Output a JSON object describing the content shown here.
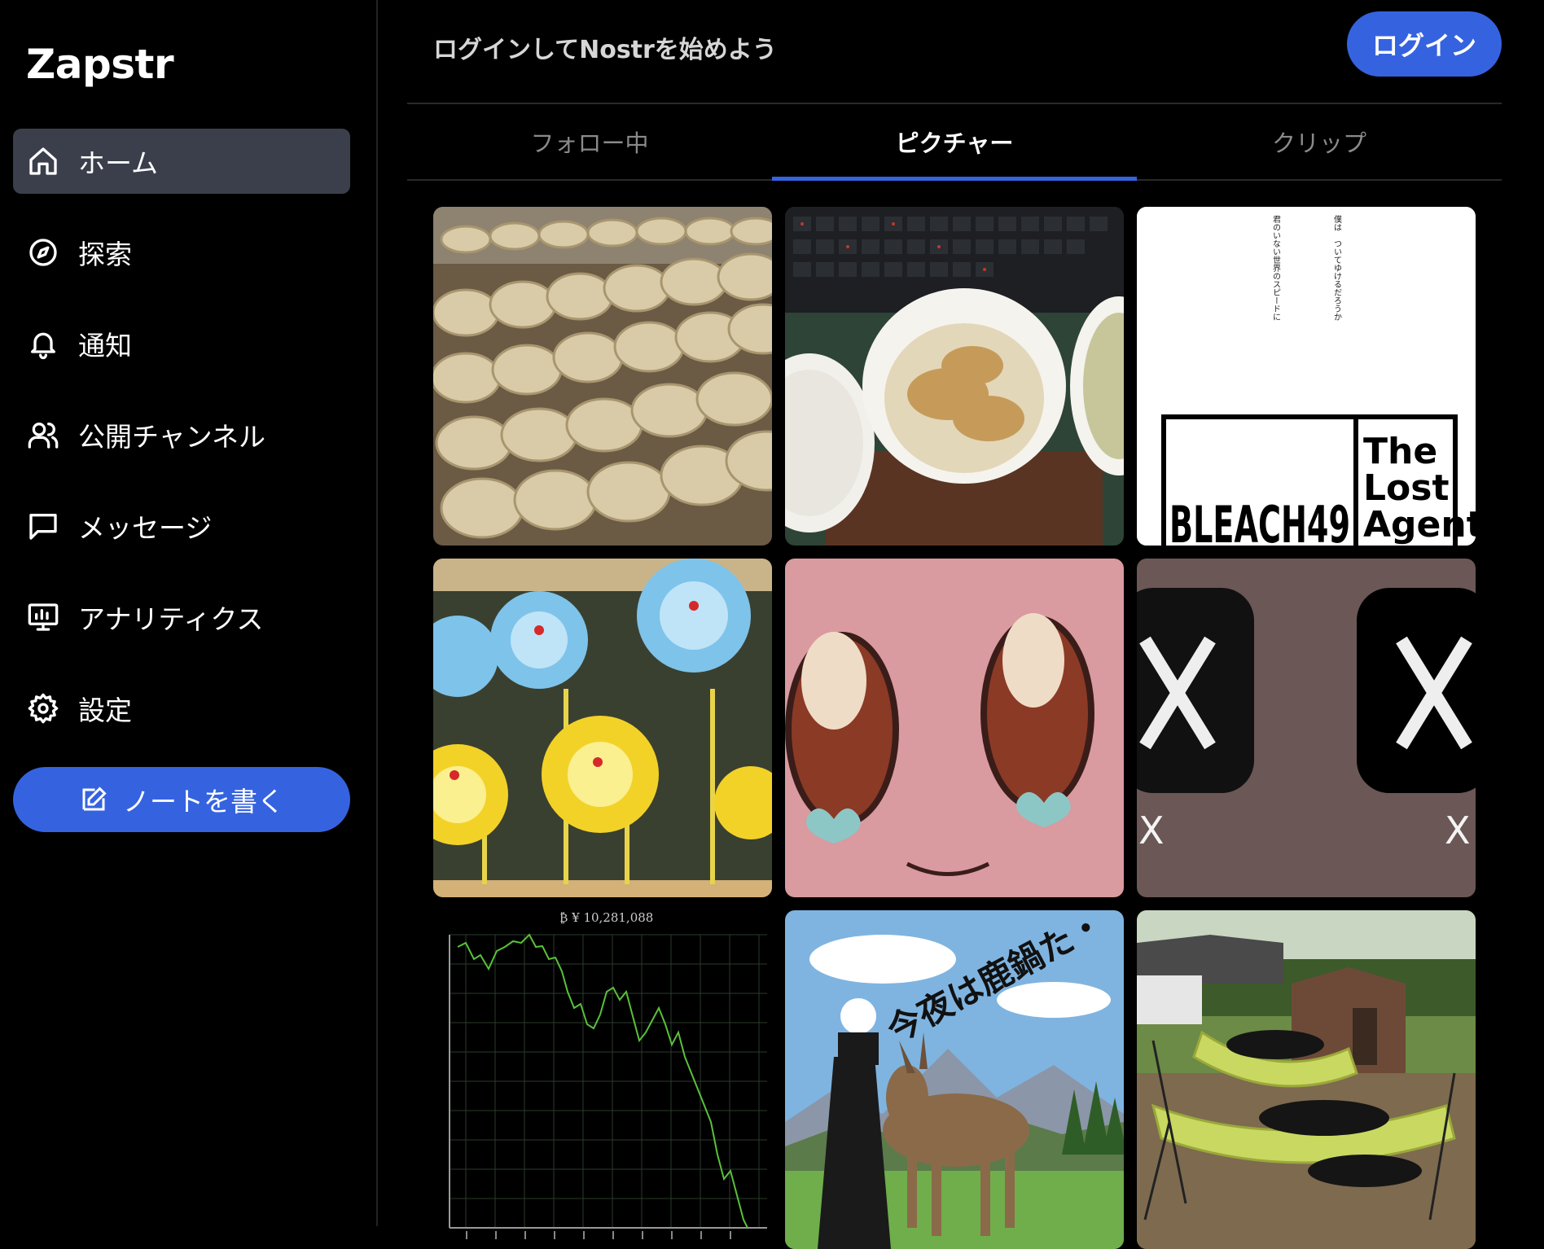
{
  "app": {
    "name": "Zapstr"
  },
  "sidebar": {
    "items": [
      {
        "label": "ホーム",
        "icon": "home-icon",
        "active": true
      },
      {
        "label": "探索",
        "icon": "compass-icon"
      },
      {
        "label": "通知",
        "icon": "bell-icon"
      },
      {
        "label": "公開チャンネル",
        "icon": "users-icon"
      },
      {
        "label": "メッセージ",
        "icon": "message-icon"
      },
      {
        "label": "アナリティクス",
        "icon": "analytics-icon"
      },
      {
        "label": "設定",
        "icon": "gear-icon"
      }
    ],
    "post_button": {
      "label": "ノートを書く",
      "icon": "edit-icon"
    }
  },
  "header": {
    "prompt": "ログインしてNostrを始めよう",
    "login_label": "ログイン"
  },
  "tabs": [
    {
      "label": "フォロー中",
      "active": false
    },
    {
      "label": "ピクチャー",
      "active": true
    },
    {
      "label": "クリップ",
      "active": false
    }
  ],
  "gallery": {
    "images": [
      {
        "subject": "gyoza"
      },
      {
        "subject": "chicken-rice-bowl"
      },
      {
        "subject": "text-poster",
        "text_lines": [
          "僕は　ついてゆけるだろうか",
          "君のいない世界のスピードに"
        ],
        "title_left": "BLEACH49",
        "title_right": [
          "The",
          "Lost",
          "Agent"
        ]
      },
      {
        "subject": "pinwheels"
      },
      {
        "subject": "plush-face"
      },
      {
        "subject": "x-logos",
        "caption_left": "X",
        "caption_right": "X"
      },
      {
        "subject": "price-chart",
        "header": "₿ ¥ 10,281,088"
      },
      {
        "subject": "deer-meme",
        "caption": "今夜は鹿鍋た・"
      },
      {
        "subject": "hammock-camp"
      }
    ]
  },
  "colors": {
    "accent": "#3563e0",
    "active_nav": "#3a3f4b",
    "background": "#000000"
  }
}
